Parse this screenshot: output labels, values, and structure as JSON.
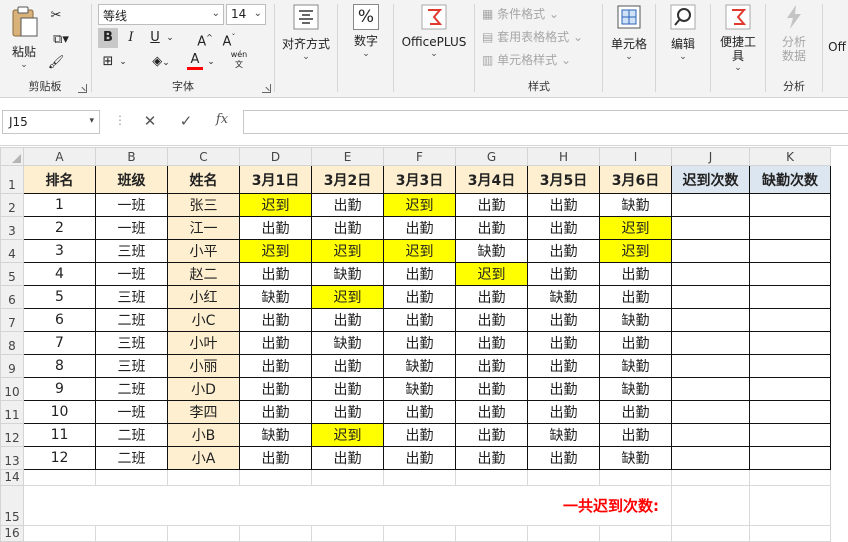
{
  "ribbon": {
    "clipboard": {
      "paste": "粘贴",
      "label": "剪贴板"
    },
    "font": {
      "name": "等线",
      "size": "14",
      "bold": "B",
      "italic": "I",
      "underline": "U",
      "grow": "A",
      "shrink": "A",
      "label": "字体",
      "phonetic": "wén"
    },
    "alignment": {
      "label": "对齐方式"
    },
    "number": {
      "label": "数字",
      "symbol": "%"
    },
    "officeplus": {
      "label": "OfficePLUS"
    },
    "styles": {
      "conditional": "条件格式",
      "table": "套用表格格式",
      "cell_style": "单元格样式",
      "label": "样式"
    },
    "cells": {
      "label": "单元格"
    },
    "editing": {
      "label": "编辑"
    },
    "tools": {
      "label_line1": "便捷工",
      "label_line2": "具"
    },
    "analysis": {
      "label_line1": "分析",
      "label_line2": "数据",
      "group_label": "分析"
    },
    "office_partial": "Off"
  },
  "formula_bar": {
    "name_box": "J15",
    "cancel": "✕",
    "enter": "✓",
    "fx": "fx",
    "value": ""
  },
  "columns": [
    "A",
    "B",
    "C",
    "D",
    "E",
    "F",
    "G",
    "H",
    "I",
    "J",
    "K"
  ],
  "header_row": [
    "排名",
    "班级",
    "姓名",
    "3月1日",
    "3月2日",
    "3月3日",
    "3月4日",
    "3月5日",
    "3月6日",
    "迟到次数",
    "缺勤次数"
  ],
  "rows": [
    [
      "1",
      "一班",
      "张三",
      "迟到",
      "出勤",
      "迟到",
      "出勤",
      "出勤",
      "缺勤",
      "",
      ""
    ],
    [
      "2",
      "一班",
      "江一",
      "出勤",
      "出勤",
      "出勤",
      "出勤",
      "出勤",
      "迟到",
      "",
      ""
    ],
    [
      "3",
      "三班",
      "小平",
      "迟到",
      "迟到",
      "迟到",
      "缺勤",
      "出勤",
      "迟到",
      "",
      ""
    ],
    [
      "4",
      "一班",
      "赵二",
      "出勤",
      "缺勤",
      "出勤",
      "迟到",
      "出勤",
      "出勤",
      "",
      ""
    ],
    [
      "5",
      "三班",
      "小红",
      "缺勤",
      "迟到",
      "出勤",
      "出勤",
      "缺勤",
      "出勤",
      "",
      ""
    ],
    [
      "6",
      "二班",
      "小C",
      "出勤",
      "出勤",
      "出勤",
      "出勤",
      "出勤",
      "缺勤",
      "",
      ""
    ],
    [
      "7",
      "三班",
      "小叶",
      "出勤",
      "缺勤",
      "出勤",
      "出勤",
      "出勤",
      "出勤",
      "",
      ""
    ],
    [
      "8",
      "三班",
      "小丽",
      "出勤",
      "出勤",
      "缺勤",
      "出勤",
      "出勤",
      "缺勤",
      "",
      ""
    ],
    [
      "9",
      "二班",
      "小D",
      "出勤",
      "出勤",
      "缺勤",
      "出勤",
      "出勤",
      "缺勤",
      "",
      ""
    ],
    [
      "10",
      "一班",
      "李四",
      "出勤",
      "出勤",
      "出勤",
      "出勤",
      "出勤",
      "出勤",
      "",
      ""
    ],
    [
      "11",
      "二班",
      "小B",
      "缺勤",
      "迟到",
      "出勤",
      "出勤",
      "缺勤",
      "出勤",
      "",
      ""
    ],
    [
      "12",
      "二班",
      "小A",
      "出勤",
      "出勤",
      "出勤",
      "出勤",
      "出勤",
      "缺勤",
      "",
      ""
    ]
  ],
  "highlights": [
    [
      0,
      3
    ],
    [
      0,
      5
    ],
    [
      1,
      8
    ],
    [
      2,
      3
    ],
    [
      2,
      4
    ],
    [
      2,
      5
    ],
    [
      2,
      8
    ],
    [
      3,
      6
    ],
    [
      4,
      4
    ],
    [
      10,
      4
    ]
  ],
  "summary_label": "一共迟到次数:",
  "colors": {
    "yellow": "#ffff00",
    "tan": "#fdefcf",
    "blue": "#dce6f1",
    "red": "#ff0000"
  }
}
